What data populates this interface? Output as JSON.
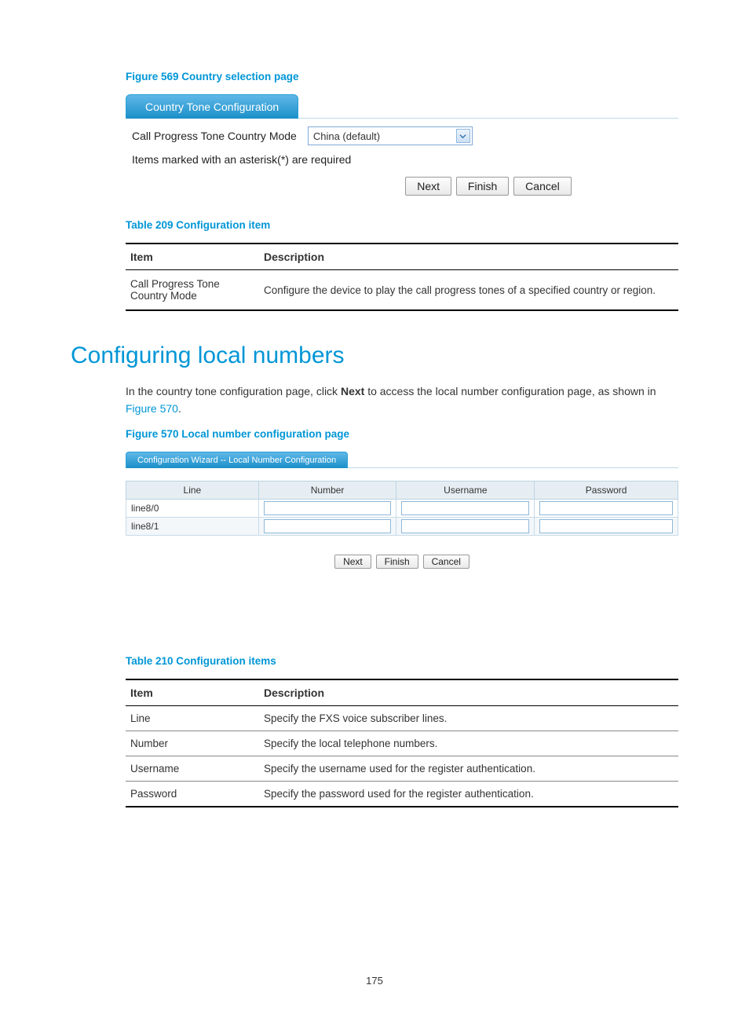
{
  "figure569": {
    "caption": "Figure 569 Country selection page",
    "tab_label": "Country Tone Configuration",
    "form_label": "Call Progress Tone Country Mode",
    "select_value": "China (default)",
    "helper": "Items marked with an asterisk(*) are required",
    "buttons": {
      "next": "Next",
      "finish": "Finish",
      "cancel": "Cancel"
    }
  },
  "table209": {
    "caption": "Table 209 Configuration item",
    "headers": {
      "item": "Item",
      "desc": "Description"
    },
    "rows": [
      {
        "item": "Call Progress Tone Country Mode",
        "desc": "Configure the device to play the call progress tones of a specified country or region."
      }
    ]
  },
  "section": {
    "heading": "Configuring local numbers",
    "para_pre": "In the country tone configuration page, click ",
    "para_bold": "Next",
    "para_mid": " to access the local number configuration page, as shown in ",
    "para_link": "Figure 570",
    "para_post": "."
  },
  "figure570": {
    "caption": "Figure 570 Local number configuration page",
    "tab_label": "Configuration Wizard -- Local Number Configuration",
    "headers": {
      "line": "Line",
      "number": "Number",
      "username": "Username",
      "password": "Password"
    },
    "rows": [
      {
        "line": "line8/0"
      },
      {
        "line": "line8/1"
      }
    ],
    "buttons": {
      "next": "Next",
      "finish": "Finish",
      "cancel": "Cancel"
    }
  },
  "table210": {
    "caption": "Table 210 Configuration items",
    "headers": {
      "item": "Item",
      "desc": "Description"
    },
    "rows": [
      {
        "item": "Line",
        "desc": "Specify the FXS voice subscriber lines."
      },
      {
        "item": "Number",
        "desc": "Specify the local telephone numbers."
      },
      {
        "item": "Username",
        "desc": "Specify the username used for the register authentication."
      },
      {
        "item": "Password",
        "desc": "Specify the password used for the register authentication."
      }
    ]
  },
  "page_number": "175"
}
